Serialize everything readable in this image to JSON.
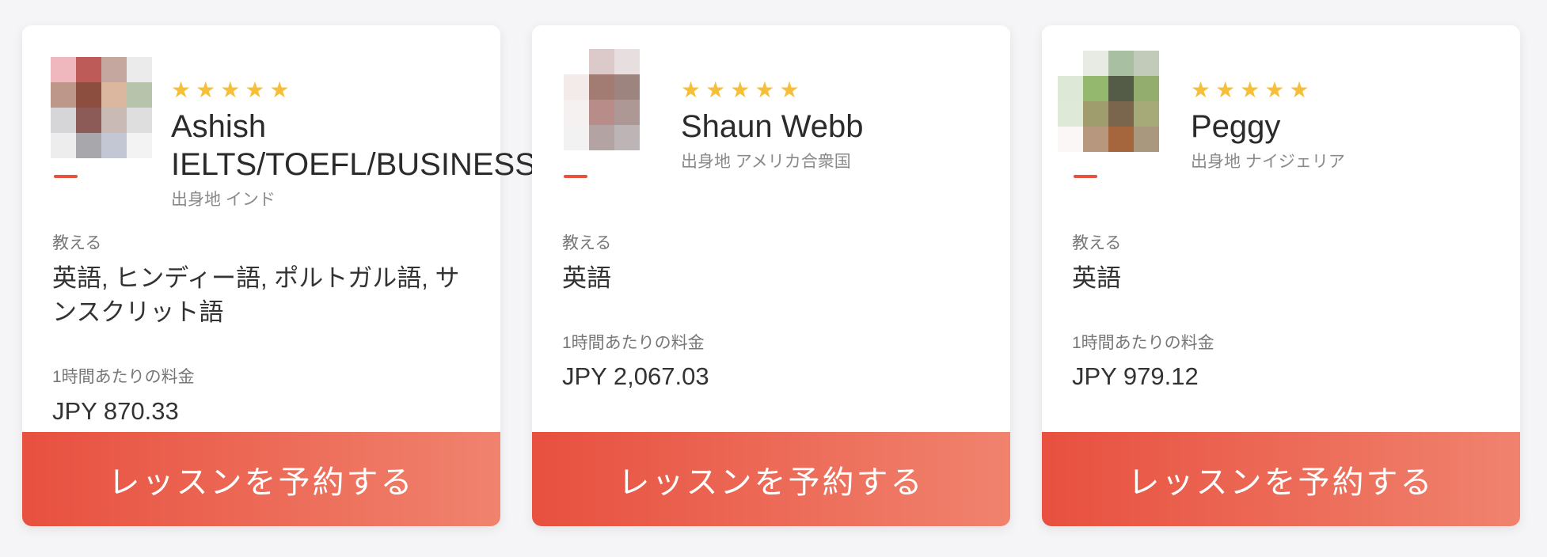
{
  "colors": {
    "accent": "#e8503f",
    "accent_end": "#f0836e",
    "star": "#f5bf3a"
  },
  "cards": [
    {
      "stars": 5,
      "name": "Ashish\nIELTS/TOEFL/BUSINESS",
      "origin": "出身地 インド",
      "teaches_label": "教える",
      "teaches": "英語, ヒンディー語, ポルトガル語, サンスクリット語",
      "rate_label": "1時間あたりの料金",
      "rate": "JPY 870.33",
      "book_label": "レッスンを予約する"
    },
    {
      "stars": 5,
      "name": "Shaun Webb",
      "origin": "出身地 アメリカ合衆国",
      "teaches_label": "教える",
      "teaches": "英語",
      "rate_label": "1時間あたりの料金",
      "rate": "JPY 2,067.03",
      "book_label": "レッスンを予約する"
    },
    {
      "stars": 5,
      "name": "Peggy",
      "origin": "出身地 ナイジェリア",
      "teaches_label": "教える",
      "teaches": "英語",
      "rate_label": "1時間あたりの料金",
      "rate": "JPY 979.12",
      "book_label": "レッスンを予約する"
    }
  ]
}
